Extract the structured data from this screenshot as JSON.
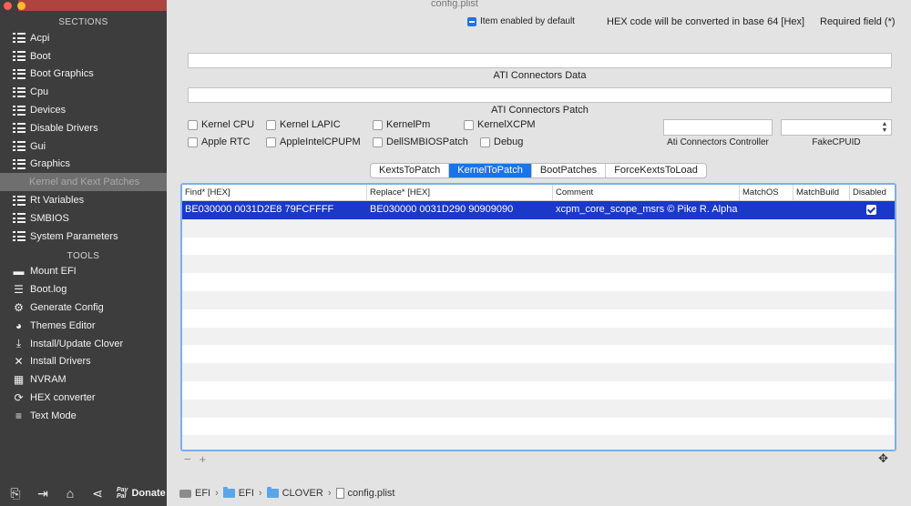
{
  "window": {
    "title": "config.plist"
  },
  "sidebar": {
    "sections_header": "SECTIONS",
    "sections": [
      {
        "label": "Acpi",
        "icon": "list-icon"
      },
      {
        "label": "Boot",
        "icon": "list-icon"
      },
      {
        "label": "Boot Graphics",
        "icon": "list-icon"
      },
      {
        "label": "Cpu",
        "icon": "list-icon"
      },
      {
        "label": "Devices",
        "icon": "list-icon"
      },
      {
        "label": "Disable Drivers",
        "icon": "list-icon"
      },
      {
        "label": "Gui",
        "icon": "list-icon"
      },
      {
        "label": "Graphics",
        "icon": "list-icon"
      },
      {
        "label": "Kernel and Kext Patches",
        "icon": "",
        "selected": true
      },
      {
        "label": "Rt Variables",
        "icon": "list-icon"
      },
      {
        "label": "SMBIOS",
        "icon": "list-icon"
      },
      {
        "label": "System Parameters",
        "icon": "list-icon"
      }
    ],
    "tools_header": "TOOLS",
    "tools": [
      {
        "label": "Mount EFI",
        "icon": "drive-icon",
        "glyph": "▬"
      },
      {
        "label": "Boot.log",
        "icon": "log-icon",
        "glyph": "☰"
      },
      {
        "label": "Generate Config",
        "icon": "gear-icon",
        "glyph": "⚙"
      },
      {
        "label": "Themes Editor",
        "icon": "palette-icon",
        "glyph": "◕"
      },
      {
        "label": "Install/Update Clover",
        "icon": "download-icon",
        "glyph": "⤓"
      },
      {
        "label": "Install Drivers",
        "icon": "tools-icon",
        "glyph": "✕"
      },
      {
        "label": "NVRAM",
        "icon": "chip-icon",
        "glyph": "▦"
      },
      {
        "label": "HEX converter",
        "icon": "convert-icon",
        "glyph": "⟳"
      },
      {
        "label": "Text Mode",
        "icon": "text-icon",
        "glyph": "≡"
      }
    ],
    "bottom": {
      "donate_label": "Donate",
      "paypal_top": "Pay",
      "paypal_bottom": "Pal"
    }
  },
  "legend": {
    "enabled_default": "Item enabled by default",
    "hex_note": "HEX code will be converted in base 64 [Hex]",
    "required": "Required field (*)"
  },
  "fields": {
    "ati_data_caption": "ATI Connectors Data",
    "ati_patch_caption": "ATI Connectors Patch",
    "ati_controller_caption": "Ati Connectors Controller",
    "fake_cpuid_caption": "FakeCPUID"
  },
  "checkboxes": {
    "row1": [
      "Kernel CPU",
      "Kernel LAPIC",
      "KernelPm",
      "KernelXCPM"
    ],
    "row2": [
      "Apple RTC",
      "AppleIntelCPUPM",
      "DellSMBIOSPatch",
      "Debug"
    ]
  },
  "tabs": [
    {
      "label": "KextsToPatch",
      "active": false
    },
    {
      "label": "KernelToPatch",
      "active": true
    },
    {
      "label": "BootPatches",
      "active": false
    },
    {
      "label": "ForceKextsToLoad",
      "active": false
    }
  ],
  "table": {
    "columns": [
      "Find* [HEX]",
      "Replace* [HEX]",
      "Comment",
      "MatchOS",
      "MatchBuild",
      "Disabled"
    ],
    "rows": [
      {
        "find": "BE030000 0031D2E8 79FCFFFF",
        "replace": "BE030000 0031D290 90909090",
        "comment": "xcpm_core_scope_msrs © Pike R. Alpha",
        "match_os": "",
        "match_build": "",
        "disabled": true
      }
    ],
    "add_label": "+",
    "remove_label": "−"
  },
  "pathbar": {
    "segments": [
      "EFI",
      "EFI",
      "CLOVER",
      "config.plist"
    ]
  },
  "colors": {
    "accent": "#1a73e8",
    "selected_row": "#1a39c9",
    "sidebar_bg": "#3d3d3e"
  }
}
